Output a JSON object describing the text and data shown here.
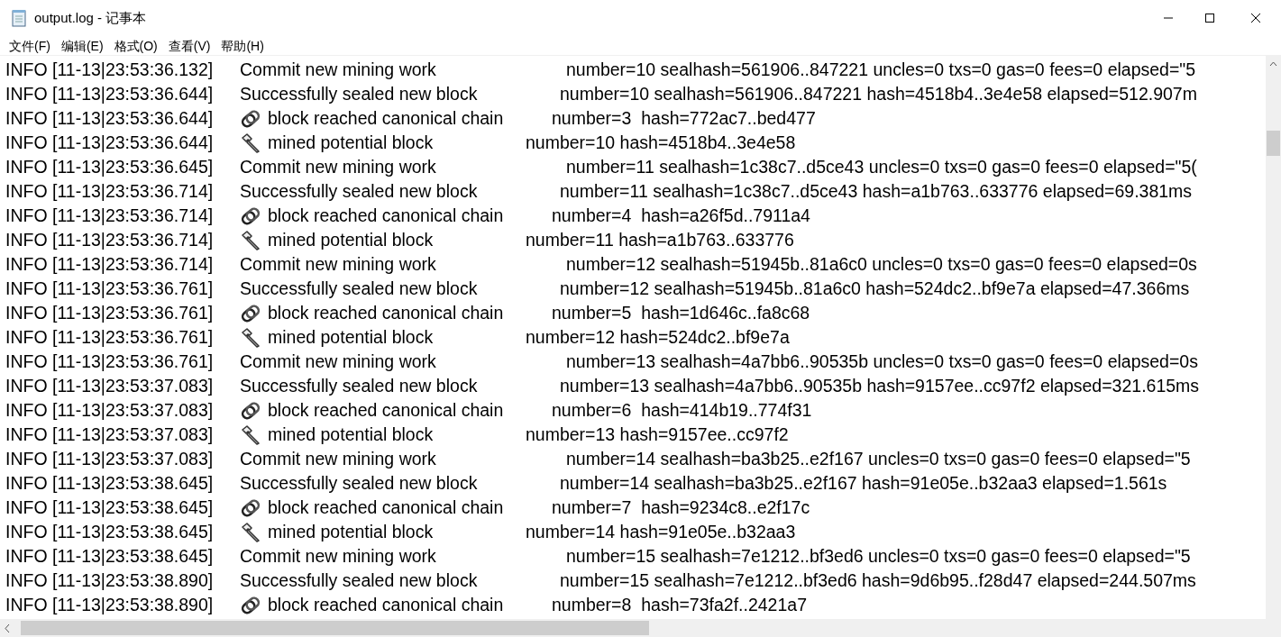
{
  "window": {
    "title": "output.log - 记事本"
  },
  "menu": [
    "文件(F)",
    "编辑(E)",
    "格式(O)",
    "查看(V)",
    "帮助(H)"
  ],
  "lines": [
    {
      "kind": "commit",
      "prefix": "INFO [11-13|23:53:36.132]",
      "message": "Commit new mining work",
      "details": "number=10 sealhash=561906..847221 uncles=0 txs=0 gas=0 fees=0 elapsed=\"5"
    },
    {
      "kind": "sealed",
      "prefix": "INFO [11-13|23:53:36.644]",
      "message": "Successfully sealed new block",
      "details": "number=10 sealhash=561906..847221 hash=4518b4..3e4e58 elapsed=512.907m"
    },
    {
      "kind": "chain",
      "prefix": "INFO [11-13|23:53:36.644]",
      "message": "block reached canonical chain",
      "details": "number=3  hash=772ac7..bed477"
    },
    {
      "kind": "mined",
      "prefix": "INFO [11-13|23:53:36.644]",
      "message": "mined potential block",
      "details": "number=10 hash=4518b4..3e4e58"
    },
    {
      "kind": "commit",
      "prefix": "INFO [11-13|23:53:36.645]",
      "message": "Commit new mining work",
      "details": "number=11 sealhash=1c38c7..d5ce43 uncles=0 txs=0 gas=0 fees=0 elapsed=\"5("
    },
    {
      "kind": "sealed",
      "prefix": "INFO [11-13|23:53:36.714]",
      "message": "Successfully sealed new block",
      "details": "number=11 sealhash=1c38c7..d5ce43 hash=a1b763..633776 elapsed=69.381ms"
    },
    {
      "kind": "chain",
      "prefix": "INFO [11-13|23:53:36.714]",
      "message": "block reached canonical chain",
      "details": "number=4  hash=a26f5d..7911a4"
    },
    {
      "kind": "mined",
      "prefix": "INFO [11-13|23:53:36.714]",
      "message": "mined potential block",
      "details": "number=11 hash=a1b763..633776"
    },
    {
      "kind": "commit",
      "prefix": "INFO [11-13|23:53:36.714]",
      "message": "Commit new mining work",
      "details": "number=12 sealhash=51945b..81a6c0 uncles=0 txs=0 gas=0 fees=0 elapsed=0s"
    },
    {
      "kind": "sealed",
      "prefix": "INFO [11-13|23:53:36.761]",
      "message": "Successfully sealed new block",
      "details": "number=12 sealhash=51945b..81a6c0 hash=524dc2..bf9e7a elapsed=47.366ms"
    },
    {
      "kind": "chain",
      "prefix": "INFO [11-13|23:53:36.761]",
      "message": "block reached canonical chain",
      "details": "number=5  hash=1d646c..fa8c68"
    },
    {
      "kind": "mined",
      "prefix": "INFO [11-13|23:53:36.761]",
      "message": "mined potential block",
      "details": "number=12 hash=524dc2..bf9e7a"
    },
    {
      "kind": "commit",
      "prefix": "INFO [11-13|23:53:36.761]",
      "message": "Commit new mining work",
      "details": "number=13 sealhash=4a7bb6..90535b uncles=0 txs=0 gas=0 fees=0 elapsed=0s"
    },
    {
      "kind": "sealed",
      "prefix": "INFO [11-13|23:53:37.083]",
      "message": "Successfully sealed new block",
      "details": "number=13 sealhash=4a7bb6..90535b hash=9157ee..cc97f2 elapsed=321.615ms"
    },
    {
      "kind": "chain",
      "prefix": "INFO [11-13|23:53:37.083]",
      "message": "block reached canonical chain",
      "details": "number=6  hash=414b19..774f31"
    },
    {
      "kind": "mined",
      "prefix": "INFO [11-13|23:53:37.083]",
      "message": "mined potential block",
      "details": "number=13 hash=9157ee..cc97f2"
    },
    {
      "kind": "commit",
      "prefix": "INFO [11-13|23:53:37.083]",
      "message": "Commit new mining work",
      "details": "number=14 sealhash=ba3b25..e2f167 uncles=0 txs=0 gas=0 fees=0 elapsed=\"5"
    },
    {
      "kind": "sealed",
      "prefix": "INFO [11-13|23:53:38.645]",
      "message": "Successfully sealed new block",
      "details": "number=14 sealhash=ba3b25..e2f167 hash=91e05e..b32aa3 elapsed=1.561s"
    },
    {
      "kind": "chain",
      "prefix": "INFO [11-13|23:53:38.645]",
      "message": "block reached canonical chain",
      "details": "number=7  hash=9234c8..e2f17c"
    },
    {
      "kind": "mined",
      "prefix": "INFO [11-13|23:53:38.645]",
      "message": "mined potential block",
      "details": "number=14 hash=91e05e..b32aa3"
    },
    {
      "kind": "commit",
      "prefix": "INFO [11-13|23:53:38.645]",
      "message": "Commit new mining work",
      "details": "number=15 sealhash=7e1212..bf3ed6 uncles=0 txs=0 gas=0 fees=0 elapsed=\"5"
    },
    {
      "kind": "sealed",
      "prefix": "INFO [11-13|23:53:38.890]",
      "message": "Successfully sealed new block",
      "details": "number=15 sealhash=7e1212..bf3ed6 hash=9d6b95..f28d47 elapsed=244.507ms"
    },
    {
      "kind": "chain",
      "prefix": "INFO [11-13|23:53:38.890]",
      "message": "block reached canonical chain",
      "details": "number=8  hash=73fa2f..2421a7"
    }
  ]
}
